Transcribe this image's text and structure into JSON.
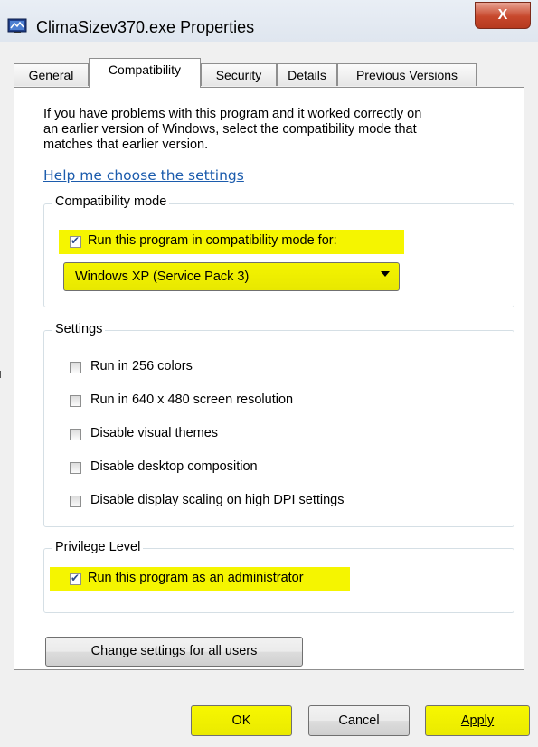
{
  "window": {
    "title": "ClimaSizev370.exe Properties",
    "close_label": "X",
    "highlight_color": "#f5f500"
  },
  "tabs": [
    {
      "label": "General",
      "active": false
    },
    {
      "label": "Compatibility",
      "active": true
    },
    {
      "label": "Security",
      "active": false
    },
    {
      "label": "Details",
      "active": false
    },
    {
      "label": "Previous Versions",
      "active": false
    }
  ],
  "intro": {
    "line1": "If you have problems with this program and it worked correctly on",
    "line2": "an earlier version of Windows, select the compatibility mode that",
    "line3": "matches that earlier version.",
    "help_link": "Help me choose the settings"
  },
  "compat_mode": {
    "legend": "Compatibility mode",
    "checkbox_label": "Run this program in compatibility mode for:",
    "checked": true,
    "selected_os": "Windows XP (Service Pack 3)"
  },
  "settings": {
    "legend": "Settings",
    "items": [
      {
        "label": "Run in 256 colors",
        "checked": false
      },
      {
        "label": "Run in 640 x 480 screen resolution",
        "checked": false
      },
      {
        "label": "Disable visual themes",
        "checked": false
      },
      {
        "label": "Disable desktop composition",
        "checked": false
      },
      {
        "label": "Disable display scaling on high DPI settings",
        "checked": false
      }
    ]
  },
  "privilege": {
    "legend": "Privilege Level",
    "checkbox_label": "Run this program as an administrator",
    "checked": true
  },
  "buttons": {
    "change_all_users": "Change settings for all users",
    "ok": "OK",
    "cancel": "Cancel",
    "apply": "Apply"
  }
}
